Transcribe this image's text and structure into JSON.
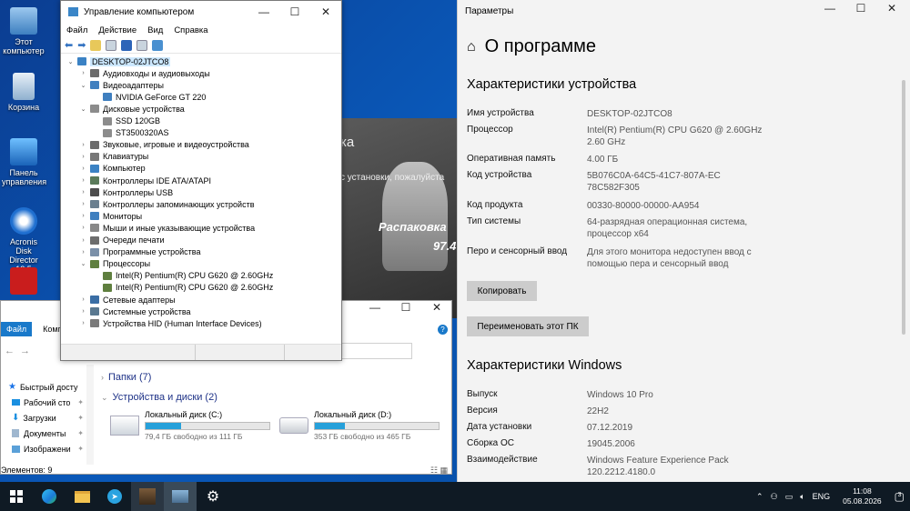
{
  "desktop": {
    "icons": [
      {
        "label": "Этот компьютер",
        "color": "#7fb6e6"
      },
      {
        "label": "Корзина",
        "color": "#b9d3ea"
      },
      {
        "label": "Панель управления",
        "color": "#2f8fd8"
      },
      {
        "label": "Acronis Disk Director 12.5",
        "color": "#1f6fd0"
      },
      {
        "label": "",
        "color": "#d41d1d"
      }
    ]
  },
  "bg_window": {
    "line1": "ка",
    "line2": "с установки, пожалуйста",
    "line3": "Распаковка",
    "line4": "97.4"
  },
  "device_manager": {
    "title": "Управление компьютером",
    "menu": [
      "Файл",
      "Действие",
      "Вид",
      "Справка"
    ],
    "tree": [
      {
        "label": "DESKTOP-02JTCO8",
        "level": 0,
        "arrow": "⌄",
        "icon": "computer",
        "selected": true
      },
      {
        "label": "Аудиовходы и аудиовыходы",
        "level": 1,
        "arrow": "›",
        "icon": "audio"
      },
      {
        "label": "Видеоадаптеры",
        "level": 1,
        "arrow": "⌄",
        "icon": "display"
      },
      {
        "label": "NVIDIA GeForce GT 220",
        "level": 2,
        "arrow": "",
        "icon": "display"
      },
      {
        "label": "Дисковые устройства",
        "level": 1,
        "arrow": "⌄",
        "icon": "disk"
      },
      {
        "label": "SSD 120GB",
        "level": 2,
        "arrow": "",
        "icon": "disk"
      },
      {
        "label": "ST3500320AS",
        "level": 2,
        "arrow": "",
        "icon": "disk"
      },
      {
        "label": "Звуковые, игровые и видеоустройства",
        "level": 1,
        "arrow": "›",
        "icon": "audio"
      },
      {
        "label": "Клавиатуры",
        "level": 1,
        "arrow": "›",
        "icon": "keyboard"
      },
      {
        "label": "Компьютер",
        "level": 1,
        "arrow": "›",
        "icon": "computer"
      },
      {
        "label": "Контроллеры IDE ATA/ATAPI",
        "level": 1,
        "arrow": "›",
        "icon": "ide"
      },
      {
        "label": "Контроллеры USB",
        "level": 1,
        "arrow": "›",
        "icon": "usb"
      },
      {
        "label": "Контроллеры запоминающих устройств",
        "level": 1,
        "arrow": "›",
        "icon": "storage"
      },
      {
        "label": "Мониторы",
        "level": 1,
        "arrow": "›",
        "icon": "display"
      },
      {
        "label": "Мыши и иные указывающие устройства",
        "level": 1,
        "arrow": "›",
        "icon": "mouse"
      },
      {
        "label": "Очереди печати",
        "level": 1,
        "arrow": "›",
        "icon": "printer"
      },
      {
        "label": "Программные устройства",
        "level": 1,
        "arrow": "›",
        "icon": "software"
      },
      {
        "label": "Процессоры",
        "level": 1,
        "arrow": "⌄",
        "icon": "cpu"
      },
      {
        "label": "Intel(R) Pentium(R) CPU G620 @ 2.60GHz",
        "level": 2,
        "arrow": "",
        "icon": "cpu"
      },
      {
        "label": "Intel(R) Pentium(R) CPU G620 @ 2.60GHz",
        "level": 2,
        "arrow": "",
        "icon": "cpu"
      },
      {
        "label": "Сетевые адаптеры",
        "level": 1,
        "arrow": "›",
        "icon": "network"
      },
      {
        "label": "Системные устройства",
        "level": 1,
        "arrow": "›",
        "icon": "system"
      },
      {
        "label": "Устройства HID (Human Interface Devices)",
        "level": 1,
        "arrow": "›",
        "icon": "hid"
      }
    ]
  },
  "explorer": {
    "ribbon_tabs": [
      "Файл",
      "Компь"
    ],
    "nav": [
      {
        "label": "Быстрый досту",
        "icon": "star"
      },
      {
        "label": "Рабочий сто",
        "icon": "desktop"
      },
      {
        "label": "Загрузки",
        "icon": "download"
      },
      {
        "label": "Документы",
        "icon": "docs"
      },
      {
        "label": "Изображени",
        "icon": "pictures"
      }
    ],
    "folders_header": "Папки (7)",
    "devices_header": "Устройства и диски (2)",
    "drives": [
      {
        "name": "Локальный диск (C:)",
        "free": "79,4 ГБ свободно из 111 ГБ",
        "used_fraction": 0.29
      },
      {
        "name": "Локальный диск (D:)",
        "free": "353 ГБ свободно из 465 ГБ",
        "used_fraction": 0.24
      }
    ],
    "status": "Элементов: 9"
  },
  "settings": {
    "app_title": "Параметры",
    "page_title": "О программе",
    "device_section": "Характеристики устройства",
    "device_specs": [
      {
        "label": "Имя устройства",
        "value": "DESKTOP-02JTCO8"
      },
      {
        "label": "Процессор",
        "value": "Intel(R) Pentium(R) CPU G620 @ 2.60GHz 2.60 GHz"
      },
      {
        "label": "Оперативная память",
        "value": "4.00 ГБ"
      },
      {
        "label": "Код устройства",
        "value": "5B076C0A-64C5-41C7-807A-EC78C582F305"
      },
      {
        "label": "Код продукта",
        "value": "00330-80000-00000-AA954"
      },
      {
        "label": "Тип системы",
        "value": "64-разрядная операционная система, процессор x64"
      },
      {
        "label": "Перо и сенсорный ввод",
        "value": "Для этого монитора недоступен ввод с помощью пера и сенсорный ввод"
      }
    ],
    "copy_button": "Копировать",
    "rename_button": "Переименовать этот ПК",
    "windows_section": "Характеристики Windows",
    "windows_specs": [
      {
        "label": "Выпуск",
        "value": "Windows 10 Pro"
      },
      {
        "label": "Версия",
        "value": "22H2"
      },
      {
        "label": "Дата установки",
        "value": "07.12.2019"
      },
      {
        "label": "Сборка ОС",
        "value": "19045.2006"
      },
      {
        "label": "Взаимодействие",
        "value": "Windows Feature Experience Pack 120.2212.4180.0"
      }
    ]
  },
  "taskbar": {
    "apps": [
      "start-icon",
      "edge-icon",
      "file-explorer-icon",
      "telegram-icon",
      "photo-app-icon",
      "device-manager-icon",
      "settings-icon"
    ],
    "language": "ENG",
    "time": "11:08",
    "date": "05.08.2026",
    "notification_count": "3"
  }
}
